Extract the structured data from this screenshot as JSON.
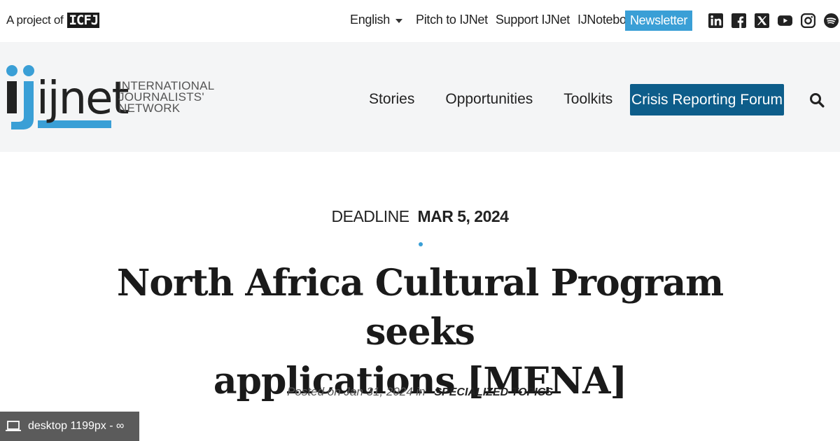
{
  "topbar": {
    "project_label": "A project of",
    "icfj_logo_text": "ICFJ",
    "language": "English",
    "links": [
      "Pitch to IJNet",
      "Support IJNet",
      "IJNotebook"
    ],
    "newsletter": "Newsletter",
    "social_icons": [
      "linkedin-icon",
      "facebook-icon",
      "x-icon",
      "youtube-icon",
      "instagram-icon",
      "spotify-icon"
    ]
  },
  "header": {
    "logo_text": "ijnet",
    "tagline": [
      "INTERNATIONAL",
      "JOURNALISTS'",
      "NETWORK"
    ],
    "nav": [
      "Stories",
      "Opportunities",
      "Toolkits"
    ],
    "crisis_button": "Crisis Reporting Forum",
    "search_icon": "search-icon"
  },
  "article": {
    "deadline_label": "DEADLINE",
    "deadline_date": "MAR 5, 2024",
    "title_line1": "North Africa Cultural Program seeks",
    "title_line2": "applications [MENA]",
    "posted": "Posted on Jan 31, 2024 in",
    "category": "SPECIALIZED TOPICS"
  },
  "viewport_badge": {
    "icon": "laptop-icon",
    "text": "desktop 1199px - ∞"
  },
  "colors": {
    "accent_blue": "#3a9fd6",
    "dark_blue": "#0d5d8a",
    "header_bg": "#f4f5f6",
    "logo_black": "#222222"
  }
}
